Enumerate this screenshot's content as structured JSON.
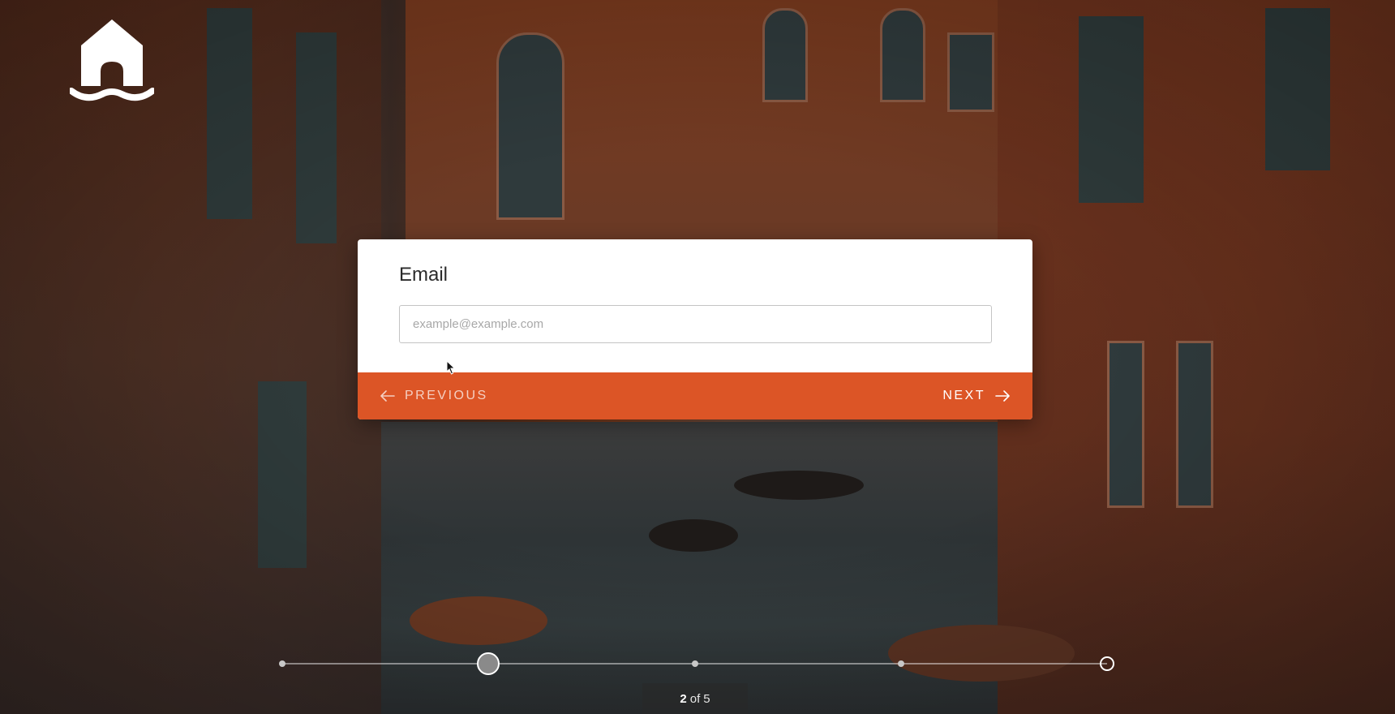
{
  "form": {
    "question_label": "Email",
    "input_placeholder": "example@example.com",
    "input_value": ""
  },
  "navigation": {
    "previous_label": "PREVIOUS",
    "next_label": "NEXT"
  },
  "progress": {
    "current": "2",
    "separator": "of",
    "total": "5",
    "step_count": 5,
    "current_step": 2
  },
  "colors": {
    "accent": "#dc5526",
    "card_background": "#ffffff",
    "label_text": "#2b2b2b",
    "placeholder_text": "#a8a8a8"
  },
  "icons": {
    "logo": "house-on-water-icon",
    "previous": "arrow-left-icon",
    "next": "arrow-right-icon"
  }
}
